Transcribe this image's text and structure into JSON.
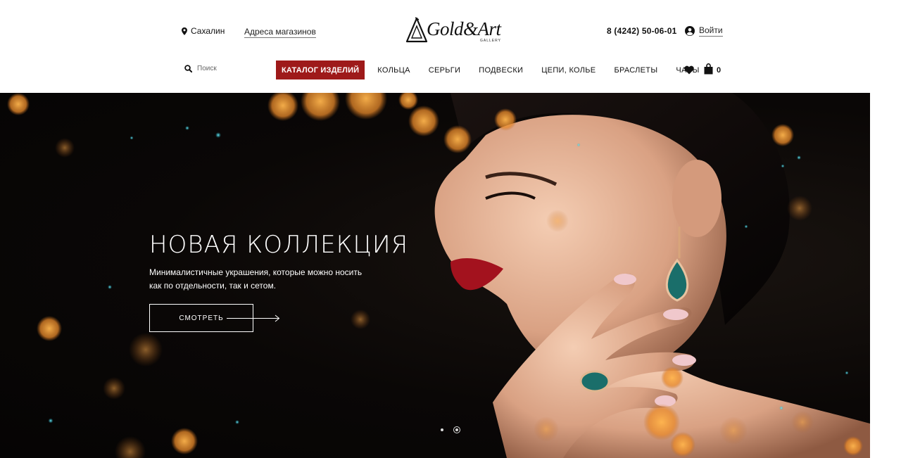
{
  "header": {
    "city": "Сахалин",
    "stores_link": "Адреса магазинов",
    "logo": {
      "text": "Gold&Art",
      "sub": "GALLERY"
    },
    "phone": "8 (4242) 50-06-01",
    "login": "Войти",
    "search": {
      "placeholder": "Поиск"
    },
    "catalog": "КАТАЛОГ ИЗДЕЛИЙ",
    "nav": [
      "КОЛЬЦА",
      "СЕРЬГИ",
      "ПОДВЕСКИ",
      "ЦЕПИ, КОЛЬЕ",
      "БРАСЛЕТЫ",
      "ЧАСЫ"
    ],
    "cart_count": "0"
  },
  "hero": {
    "title": "НОВАЯ КОЛЛЕКЦИЯ",
    "text": "Минималистичные украшения, которые можно носить как по отдельности, так и сетом.",
    "button": "СМОТРЕТЬ",
    "slides": 2,
    "active_slide": 2
  },
  "colors": {
    "accent": "#9e1a1a",
    "hero_bg": "#0a0706",
    "bokeh": "#f0a040",
    "sparkle": "#1fa6b8"
  }
}
